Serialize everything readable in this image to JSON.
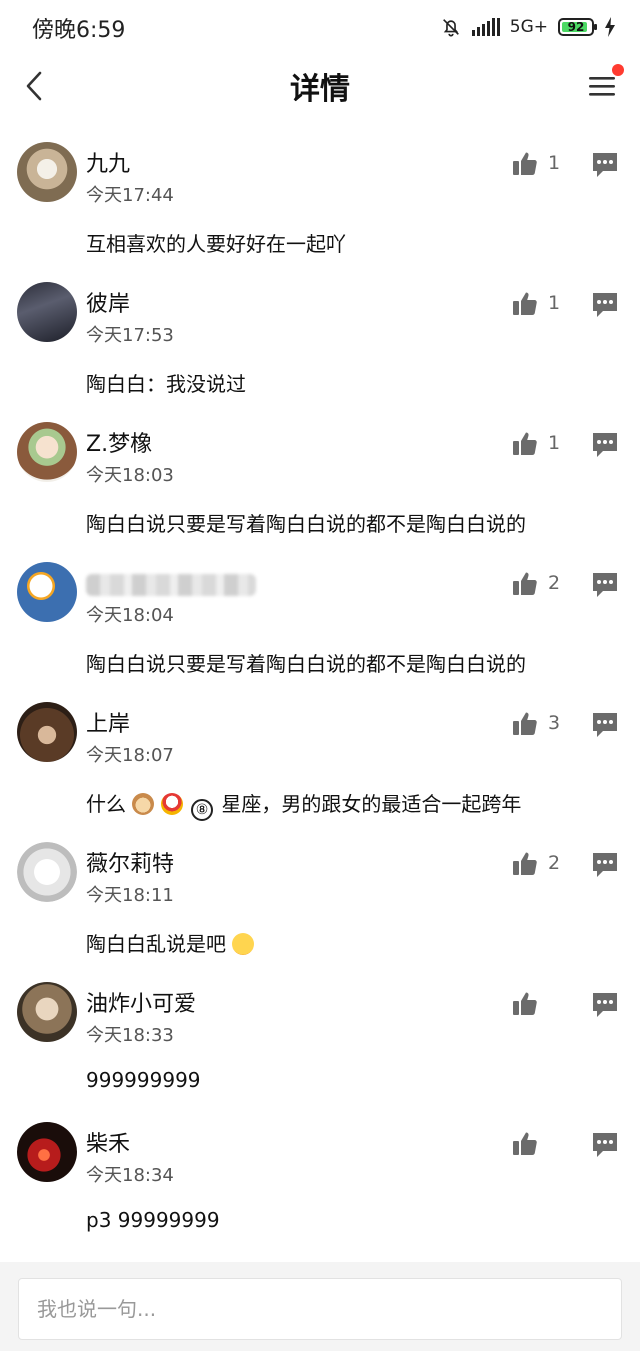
{
  "status_bar": {
    "time": "傍晚6:59",
    "network": "5G+",
    "battery": "92",
    "battery_level": 0.92
  },
  "nav": {
    "title": "详情",
    "back_icon": "chevron-left-icon",
    "menu_icon": "menu-icon",
    "menu_badge_color": "#ff3b30"
  },
  "comments": [
    {
      "name": "九九",
      "time": "今天17:44",
      "content": "互相喜欢的人要好好在一起吖",
      "likes": "1"
    },
    {
      "name": "彼岸",
      "time": "今天17:53",
      "content": "陶白白：我没说过",
      "likes": "1"
    },
    {
      "name": "Z.梦橡",
      "time": "今天18:03",
      "content": "陶白白说只要是写着陶白白说的都不是陶白白说的",
      "likes": "1"
    },
    {
      "name": "",
      "time": "今天18:04",
      "content": "陶白白说只要是写着陶白白说的都不是陶白白说的",
      "likes": "2"
    },
    {
      "name": "上岸",
      "time": "今天18:07",
      "content_prefix": "什么",
      "content_badge": "⑧",
      "content_suffix": "星座，男的跟女的最适合一起跨年",
      "likes": "3"
    },
    {
      "name": "薇尔莉特",
      "time": "今天18:11",
      "content": "陶白白乱说是吧",
      "likes": "2"
    },
    {
      "name": "油炸小可爱",
      "time": "今天18:33",
      "content": "999999999",
      "likes": ""
    },
    {
      "name": "柴禾",
      "time": "今天18:34",
      "content": "p3 99999999",
      "likes": ""
    }
  ],
  "input": {
    "placeholder": "我也说一句..."
  },
  "colors": {
    "icon_gray": "#6b6b6b",
    "battery_green": "#4cd964"
  }
}
